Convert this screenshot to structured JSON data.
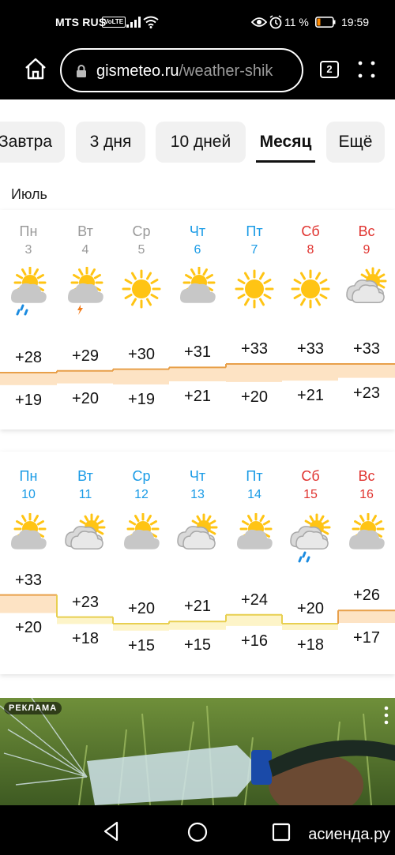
{
  "status_bar": {
    "carrier": "MTS RUS",
    "volte": "VoLTE",
    "battery_percent": "11 %",
    "time": "19:59"
  },
  "browser": {
    "url_domain": "gismeteo.ru",
    "url_rest": "/weather-shik",
    "tabs_count": "2"
  },
  "nav_tabs": [
    {
      "label": "Завтра",
      "active": false
    },
    {
      "label": "3 дня",
      "active": false
    },
    {
      "label": "10 дней",
      "active": false
    },
    {
      "label": "Месяц",
      "active": true
    },
    {
      "label": "Ещё",
      "active": false
    }
  ],
  "month": "Июль",
  "weeks": [
    {
      "days": [
        {
          "name": "Пн",
          "num": "3",
          "kind": "past",
          "icon": "partly-cloudy-rain-icon",
          "max": "+28",
          "min": "+19"
        },
        {
          "name": "Вт",
          "num": "4",
          "kind": "past",
          "icon": "partly-cloudy-thunder-icon",
          "max": "+29",
          "min": "+20"
        },
        {
          "name": "Ср",
          "num": "5",
          "kind": "past",
          "icon": "sun-icon",
          "max": "+30",
          "min": "+19"
        },
        {
          "name": "Чт",
          "num": "6",
          "kind": "weekday",
          "icon": "partly-cloudy-icon",
          "max": "+31",
          "min": "+21"
        },
        {
          "name": "Пт",
          "num": "7",
          "kind": "weekday",
          "icon": "sun-icon",
          "max": "+33",
          "min": "+20"
        },
        {
          "name": "Сб",
          "num": "8",
          "kind": "weekend",
          "icon": "sun-icon",
          "max": "+33",
          "min": "+21"
        },
        {
          "name": "Вс",
          "num": "9",
          "kind": "weekend",
          "icon": "cloudy-sun-icon",
          "max": "+33",
          "min": "+23"
        }
      ]
    },
    {
      "days": [
        {
          "name": "Пн",
          "num": "10",
          "kind": "weekday",
          "icon": "partly-cloudy-icon",
          "max": "+33",
          "min": "+20"
        },
        {
          "name": "Вт",
          "num": "11",
          "kind": "weekday",
          "icon": "cloudy-sun-icon",
          "max": "+23",
          "min": "+18"
        },
        {
          "name": "Ср",
          "num": "12",
          "kind": "weekday",
          "icon": "partly-cloudy-icon",
          "max": "+20",
          "min": "+15"
        },
        {
          "name": "Чт",
          "num": "13",
          "kind": "weekday",
          "icon": "cloudy-sun-icon",
          "max": "+21",
          "min": "+15"
        },
        {
          "name": "Пт",
          "num": "14",
          "kind": "weekday",
          "icon": "partly-cloudy-icon",
          "max": "+24",
          "min": "+16"
        },
        {
          "name": "Сб",
          "num": "15",
          "kind": "weekend",
          "icon": "cloudy-sun-rain-icon",
          "max": "+20",
          "min": "+18"
        },
        {
          "name": "Вс",
          "num": "16",
          "kind": "weekend",
          "icon": "partly-cloudy-icon",
          "max": "+26",
          "min": "+17"
        }
      ]
    }
  ],
  "ad": {
    "label": "РЕКЛАМА"
  },
  "watermark": "асиенда.ру",
  "colors": {
    "weekday": "#1a9be6",
    "weekend": "#e0332f",
    "past": "#9a9a9a",
    "warm_band": "#fde3c4",
    "warm_line": "#e8a04a",
    "cool_band": "#fdf4c8",
    "cool_line": "#e8cf50",
    "sun": "#ffc414"
  }
}
